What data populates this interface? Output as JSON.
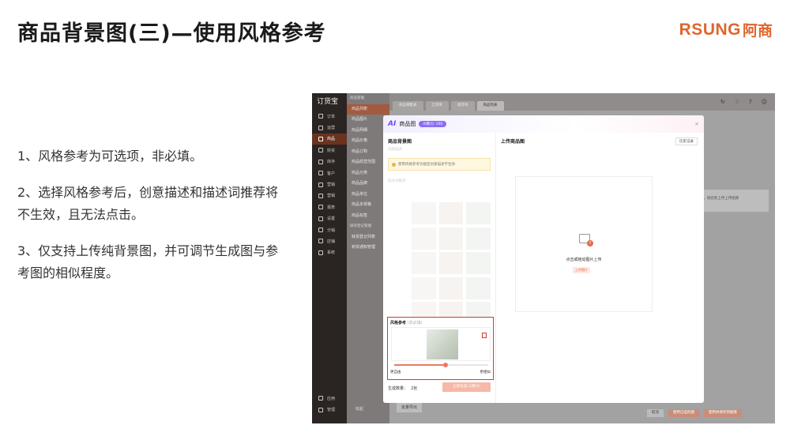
{
  "slide": {
    "title": "商品背景图(三)—使用风格参考",
    "brand_en": "RSUNG",
    "brand_cn": "阿商",
    "notes": [
      "1、风格参考为可选项，非必填。",
      "2、选择风格参考后，创意描述和描述词推荐将不生效，且无法点击。",
      "3、仅支持上传纯背景图，并可调节生成图与参考图的相似程度。"
    ]
  },
  "app": {
    "logo": "订货宝",
    "nav": [
      "订单",
      "运营",
      "商品",
      "财资",
      "库存",
      "客户",
      "营销",
      "营销",
      "报表",
      "设置",
      "分销",
      "店铺",
      "系统"
    ],
    "nav_bottom": [
      "应用",
      "管理"
    ],
    "sub_head": "商品管理",
    "sub_items": [
      "商品列表",
      "商品图片",
      "商品明细",
      "商品价格",
      "商品订购",
      "商品经营范围",
      "商品分类",
      "商品品牌",
      "商品单位",
      "商品多规格",
      "商品标签"
    ],
    "sub_head2": "缺货登记管理",
    "sub_items2": [
      "缺货登记列表",
      "到货通知管理"
    ],
    "collapse_label": "收起",
    "tabs": [
      "商品销售表",
      "订货单",
      "退货单",
      "商品列表"
    ],
    "batch_label": "批量导出",
    "hint_text": "...到图，请您新上传上传图库",
    "bottom_buttons": [
      "取消",
      "使用已选的图",
      "使用并保存到图库"
    ]
  },
  "modal": {
    "ai_logo": "AI",
    "title": "商品图",
    "ai_badge": "AI算力: 100",
    "close": "×",
    "left_title": "商品背景图",
    "left_sub": "创意描述",
    "warning": "使用风格参考功能后创意描述不生效",
    "faded_label": "描述词推荐",
    "thumb_labels": [
      "",
      "",
      "",
      "",
      "",
      "",
      "",
      ""
    ],
    "style_ref_title": "风格参考",
    "style_ref_optional": "(非必填)",
    "delete_icon": "🗑",
    "slider_left": "更自由",
    "slider_right": "更相似",
    "similarity": 0.55,
    "gen_count_label": "生成数量：",
    "gen_count_value": "2张",
    "gen_button": "立即生成 (2算力)",
    "right_title": "上传商品图",
    "history_button": "历史记录",
    "upload_text": "点击或拖动图片上传",
    "upload_link": "上传图片"
  }
}
